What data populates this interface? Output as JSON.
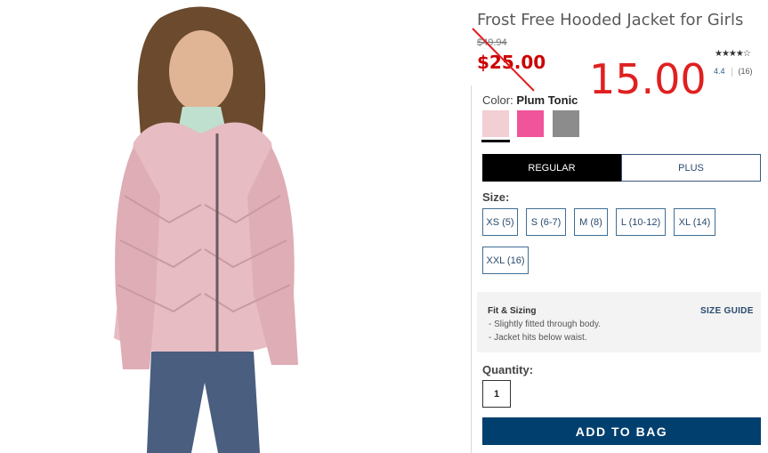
{
  "product": {
    "title": "Frost Free Hooded Jacket for Girls",
    "old_price": "$49.94",
    "price": "$25.00",
    "rating_stars": "★★★★☆",
    "rating_value": "4.4",
    "review_count": "(16)",
    "image_alt": "product-photo"
  },
  "annotation": {
    "handwritten_price": "15.00",
    "color": "#e02020"
  },
  "color": {
    "label": "Color:",
    "selected": "Plum Tonic",
    "swatches": [
      {
        "name": "plum-tonic-swatch",
        "color": "#f2cfd3",
        "selected": true
      },
      {
        "name": "pink-swatch",
        "color": "#f0549a",
        "selected": false
      },
      {
        "name": "grey-swatch",
        "color": "#8c8c8c",
        "selected": false
      }
    ]
  },
  "fit": {
    "options": [
      "REGULAR",
      "PLUS"
    ],
    "selected": "REGULAR"
  },
  "size": {
    "label": "Size:",
    "options": [
      "XS (5)",
      "S (6-7)",
      "M (8)",
      "L (10-12)",
      "XL (14)",
      "XXL (16)"
    ]
  },
  "fit_sizing": {
    "title": "Fit & Sizing",
    "notes": [
      "- Slightly fitted through body.",
      "- Jacket hits below waist."
    ],
    "size_guide": "SIZE GUIDE"
  },
  "quantity": {
    "label": "Quantity:",
    "value": "1"
  },
  "cart": {
    "add_label": "ADD TO BAG",
    "button_color": "#003f6e"
  }
}
